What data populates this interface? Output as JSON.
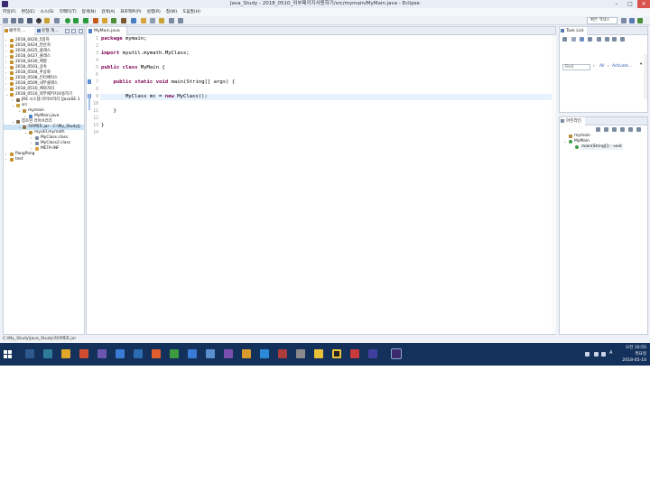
{
  "window": {
    "title": "Java_Study - 2018_0510_외부패키지사용하기/src/mymain/MyMain.java - Eclipse",
    "controls": {
      "minimize": "–",
      "maximize": "□",
      "close": "✕"
    }
  },
  "menu": {
    "items": [
      "파일(F)",
      "편집(E)",
      "소스(S)",
      "리팩터(T)",
      "탐색(N)",
      "검색(A)",
      "프로젝트(P)",
      "실행(R)",
      "창(W)",
      "도움말(H)"
    ]
  },
  "toolbar": {
    "quick_access": "빠른 액세스"
  },
  "left_panel": {
    "tabs": [
      "패키지 ...",
      "유형 계..."
    ],
    "tree": [
      {
        "label": "2018_0420_5일차",
        "expanded": false,
        "level": 0
      },
      {
        "label": "2018_0424_연산자",
        "expanded": false,
        "level": 0
      },
      {
        "label": "2018_0425_클래스",
        "expanded": false,
        "level": 0
      },
      {
        "label": "2018_0427_클래스",
        "expanded": false,
        "level": 0
      },
      {
        "label": "2018_0430_배열",
        "expanded": false,
        "level": 0
      },
      {
        "label": "2018_0503_상속",
        "expanded": false,
        "level": 0
      },
      {
        "label": "2018_0504_추상화",
        "expanded": false,
        "level": 0
      },
      {
        "label": "2018_0508_인터페이스",
        "expanded": false,
        "level": 0
      },
      {
        "label": "2018_0509_내부클래스",
        "expanded": false,
        "level": 0
      },
      {
        "label": "2018_0510_예외처리",
        "expanded": false,
        "level": 0
      },
      {
        "label": "2018_0510_외부패키지사용하기",
        "expanded": true,
        "level": 0
      },
      {
        "label": "JRE 시스템 라이브러리 [JavaSE-1",
        "expanded": false,
        "level": 1
      },
      {
        "label": "src",
        "expanded": true,
        "level": 1
      },
      {
        "label": "mymain",
        "expanded": true,
        "level": 2
      },
      {
        "label": "MyMain.java",
        "expanded": false,
        "level": 3
      },
      {
        "label": "참조된 라이브러리",
        "expanded": true,
        "level": 1
      },
      {
        "label": "자바배포.jar - C:\\My_Study\\J",
        "expanded": true,
        "level": 2,
        "selected": true
      },
      {
        "label": "myutil.mymath",
        "expanded": true,
        "level": 3
      },
      {
        "label": "MyClass.class",
        "expanded": false,
        "level": 4
      },
      {
        "label": "MyClass2.class",
        "expanded": false,
        "level": 4
      },
      {
        "label": "META-INF",
        "expanded": false,
        "level": 4
      },
      {
        "label": "PangPang",
        "expanded": false,
        "level": 0
      },
      {
        "label": "test",
        "expanded": false,
        "level": 0
      }
    ]
  },
  "editor": {
    "tab_label": "MyMain.java",
    "lines": [
      {
        "n": "1",
        "text": "package mymain;"
      },
      {
        "n": "2",
        "text": ""
      },
      {
        "n": "3",
        "text": "import myutil.mymath.MyClass;"
      },
      {
        "n": "4",
        "text": ""
      },
      {
        "n": "5",
        "text": "public class MyMain {"
      },
      {
        "n": "6",
        "text": ""
      },
      {
        "n": "7",
        "text": "    public static void main(String[] args) {"
      },
      {
        "n": "8",
        "text": ""
      },
      {
        "n": "9",
        "text": "        MyClass mc = new MyClass();"
      },
      {
        "n": "10",
        "text": ""
      },
      {
        "n": "11",
        "text": "    }"
      },
      {
        "n": "12",
        "text": ""
      },
      {
        "n": "13",
        "text": "}"
      },
      {
        "n": "14",
        "text": ""
      }
    ],
    "current_line": "9"
  },
  "task_list": {
    "tab_label": "Task List",
    "find_placeholder": "Find",
    "all_label": "All",
    "activate_label": "Activate..."
  },
  "outline": {
    "tab_label": "아웃라인",
    "items": [
      {
        "label": "mymain",
        "level": 0
      },
      {
        "label": "MyMain",
        "level": 0
      },
      {
        "label": "main(String[]) : void",
        "level": 1
      }
    ]
  },
  "status_bar": {
    "text": "C:\\My_Study\\Java_Study\\자바배포.jar"
  },
  "taskbar": {
    "clock_time": "오전 10:55",
    "clock_day": "목요일",
    "clock_date": "2018-05-10",
    "ime": "A"
  },
  "colors": {
    "keyword": "#7f0055",
    "taskbar": "#14315c",
    "selection": "#cde3f6",
    "current_line": "#e8f2fe"
  }
}
